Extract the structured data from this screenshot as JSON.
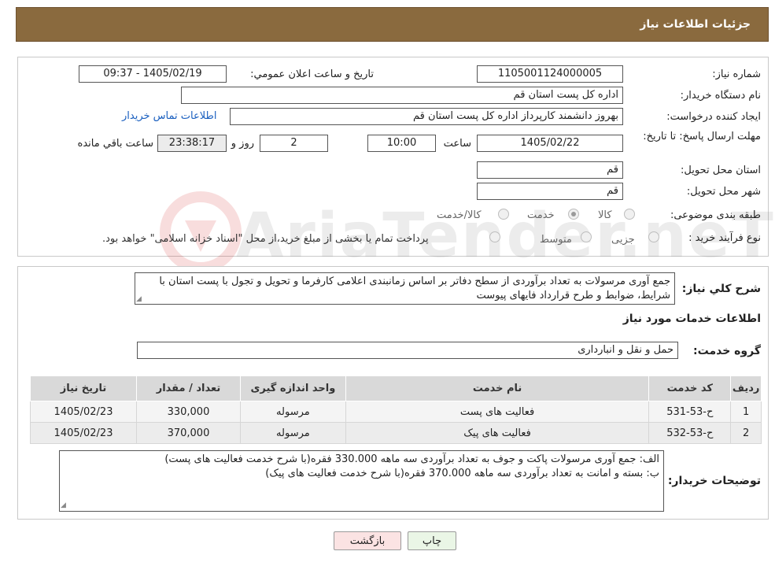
{
  "header": {
    "title": "جزئيات اطلاعات نياز"
  },
  "form": {
    "need_number_label": "شماره نياز:",
    "need_number": "1105001124000005",
    "announce_label": "تاريخ و ساعت اعلان عمومي:",
    "announce_value": "1405/02/19 - 09:37",
    "buyer_org_label": "نام دستگاه خريدار:",
    "buyer_org": "اداره کل پست استان قم",
    "creator_label": "ايجاد کننده درخواست:",
    "creator": "بهروز دانشمند کارپرداز اداره کل پست استان قم",
    "contact_link": "اطلاعات تماس خريدار",
    "deadline_label": "مهلت ارسال پاسخ: تا تاريخ:",
    "deadline_date": "1405/02/22",
    "time_label": "ساعت",
    "deadline_time": "10:00",
    "days_value": "2",
    "days_label": "روز و",
    "remaining_time": "23:38:17",
    "remaining_label": "ساعت باقي مانده",
    "province_label": "استان محل تحويل:",
    "province": "قم",
    "city_label": "شهر محل تحويل:",
    "city": "قم",
    "category_label": "طبقه بندی موضوعی:",
    "category_options": [
      "کالا",
      "خدمت",
      "کالا/خدمت"
    ],
    "process_label": "نوع فرآیند خرید :",
    "process_options": [
      "جزیی",
      "متوسط"
    ],
    "process_note": "پرداخت تمام یا بخشی از مبلغ خرید،از محل \"اسناد خزانه اسلامی\" خواهد بود."
  },
  "summary": {
    "label": "شرح کلي نياز:",
    "text": "جمع آوری مرسولات به تعداد برآوردی از سطح دفاتر بر اساس زمانبندی اعلامی کارفرما و تحویل و تجول با پست استان با شرایط، ضوابط و طرح قرارداد فایهای پیوست",
    "services_title": "اطلاعات خدمات مورد نياز",
    "service_group_label": "گروه خدمت:",
    "service_group": "حمل و نقل و انبارداری"
  },
  "table": {
    "headers": [
      "رديف",
      "کد خدمت",
      "نام خدمت",
      "واحد اندازه گيری",
      "تعداد / مقدار",
      "تاريخ نياز"
    ],
    "rows": [
      [
        "1",
        "ح-53-531",
        "فعالیت های پست",
        "مرسوله",
        "330,000",
        "1405/02/23"
      ],
      [
        "2",
        "ح-53-532",
        "فعالیت های پیک",
        "مرسوله",
        "370,000",
        "1405/02/23"
      ]
    ]
  },
  "buyer_notes": {
    "label": "توضيحات خريدار:",
    "line1": "الف: جمع آوری مرسولات پاکت و جوف به تعداد برآوردی سه ماهه 330.000 فقره(با شرح خدمت فعالیت های پست)",
    "line2": "ب: بسته و امانت به تعداد برآوردی سه ماهه 370.000 فقره(با شرح خدمت فعالیت های پیک)"
  },
  "buttons": {
    "print": "چاپ",
    "back": "بازگشت"
  },
  "watermark": {
    "text": "AriaTender.neT"
  },
  "colors": {
    "header_bg": "#8a6a3e",
    "link": "#1a5fbf",
    "back_btn_bg": "#fbe3e3",
    "print_btn_bg": "#eaf6e6"
  }
}
